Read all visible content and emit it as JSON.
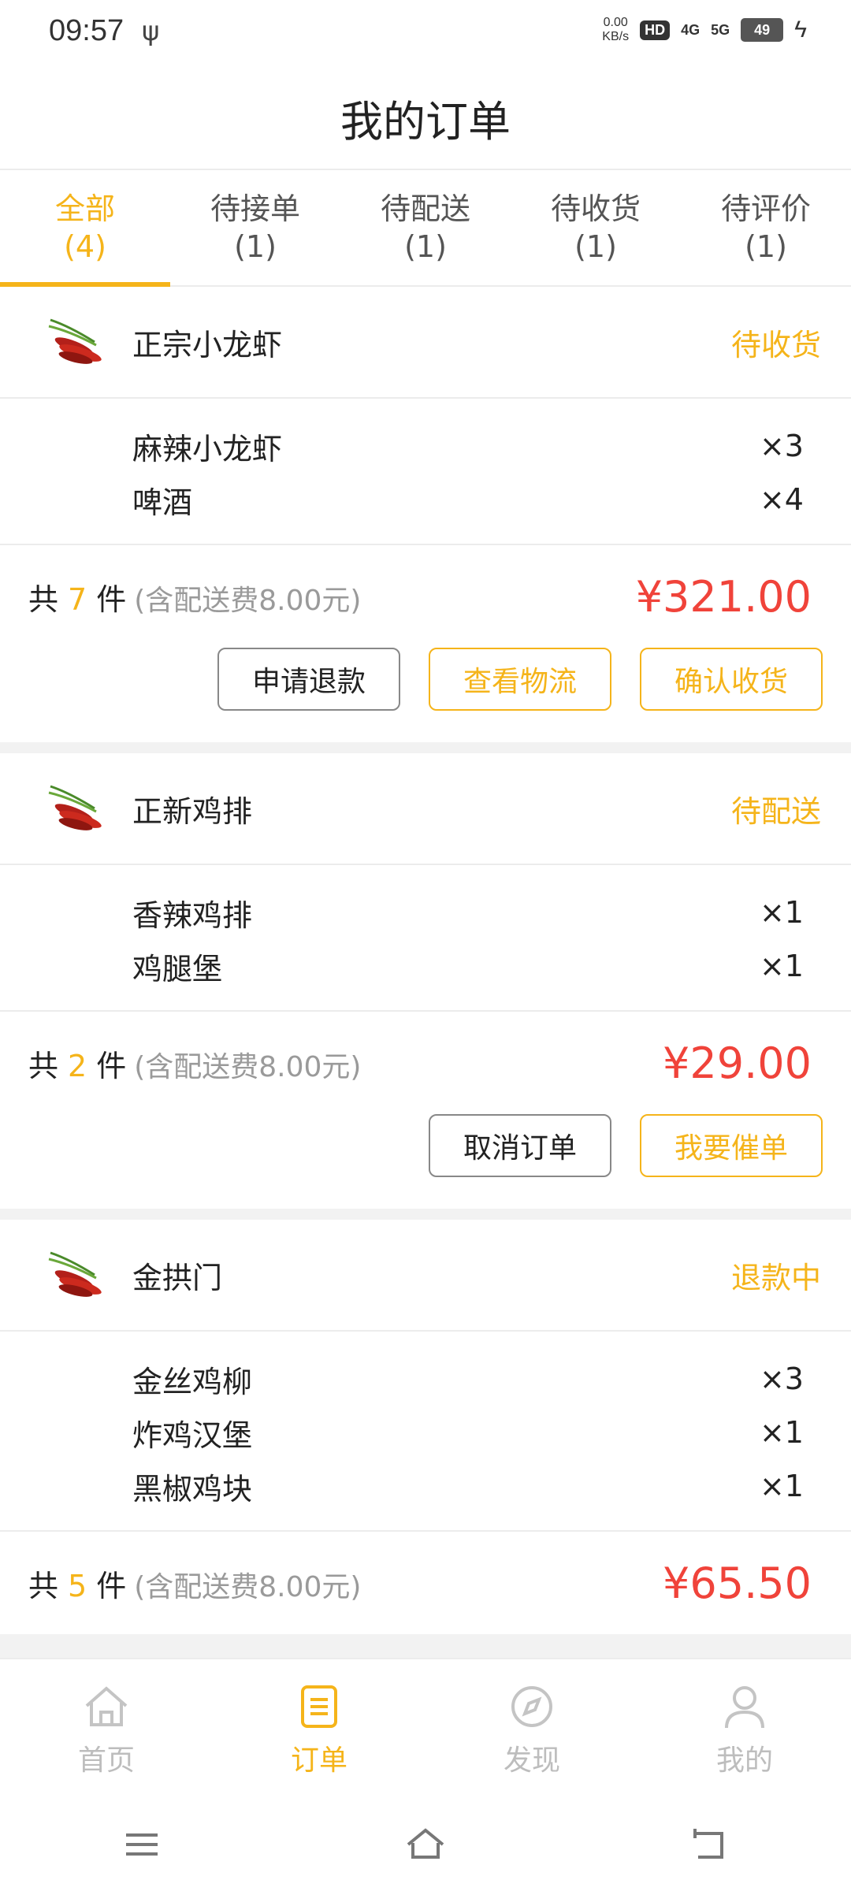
{
  "status_bar": {
    "time": "09:57",
    "speed_value": "0.00",
    "speed_unit": "KB/s",
    "hd": "HD",
    "net1": "4G",
    "net2": "5G",
    "battery": "49"
  },
  "header": {
    "title": "我的订单"
  },
  "tabs": [
    {
      "label": "全部",
      "count": "(4)",
      "active": true
    },
    {
      "label": "待接单",
      "count": "(1)"
    },
    {
      "label": "待配送",
      "count": "(1)"
    },
    {
      "label": "待收货",
      "count": "(1)"
    },
    {
      "label": "待评价",
      "count": "(1)"
    }
  ],
  "orders": [
    {
      "shop": "正宗小龙虾",
      "status": "待收货",
      "items": [
        {
          "name": "麻辣小龙虾",
          "qty": "×3"
        },
        {
          "name": "啤酒",
          "qty": "×4"
        }
      ],
      "total_prefix": "共",
      "count": "7",
      "total_suffix": "件",
      "fee": "(含配送费8.00元)",
      "price": "¥321.00",
      "buttons": [
        "申请退款",
        "查看物流",
        "确认收货"
      ]
    },
    {
      "shop": "正新鸡排",
      "status": "待配送",
      "items": [
        {
          "name": "香辣鸡排",
          "qty": "×1"
        },
        {
          "name": "鸡腿堡",
          "qty": "×1"
        }
      ],
      "total_prefix": "共",
      "count": "2",
      "total_suffix": "件",
      "fee": "(含配送费8.00元)",
      "price": "¥29.00",
      "buttons": [
        "取消订单",
        "我要催单"
      ]
    },
    {
      "shop": "金拱门",
      "status": "退款中",
      "items": [
        {
          "name": "金丝鸡柳",
          "qty": "×3"
        },
        {
          "name": "炸鸡汉堡",
          "qty": "×1"
        },
        {
          "name": "黑椒鸡块",
          "qty": "×1"
        }
      ],
      "total_prefix": "共",
      "count": "5",
      "total_suffix": "件",
      "fee": "(含配送费8.00元)",
      "price": "¥65.50"
    }
  ],
  "bottom_nav": [
    {
      "label": "首页",
      "icon": "home-icon"
    },
    {
      "label": "订单",
      "icon": "order-icon",
      "active": true
    },
    {
      "label": "发现",
      "icon": "compass-icon"
    },
    {
      "label": "我的",
      "icon": "profile-icon"
    }
  ],
  "colors": {
    "accent": "#f5b41a",
    "price": "#f0433a",
    "muted": "#9a9a9a"
  }
}
